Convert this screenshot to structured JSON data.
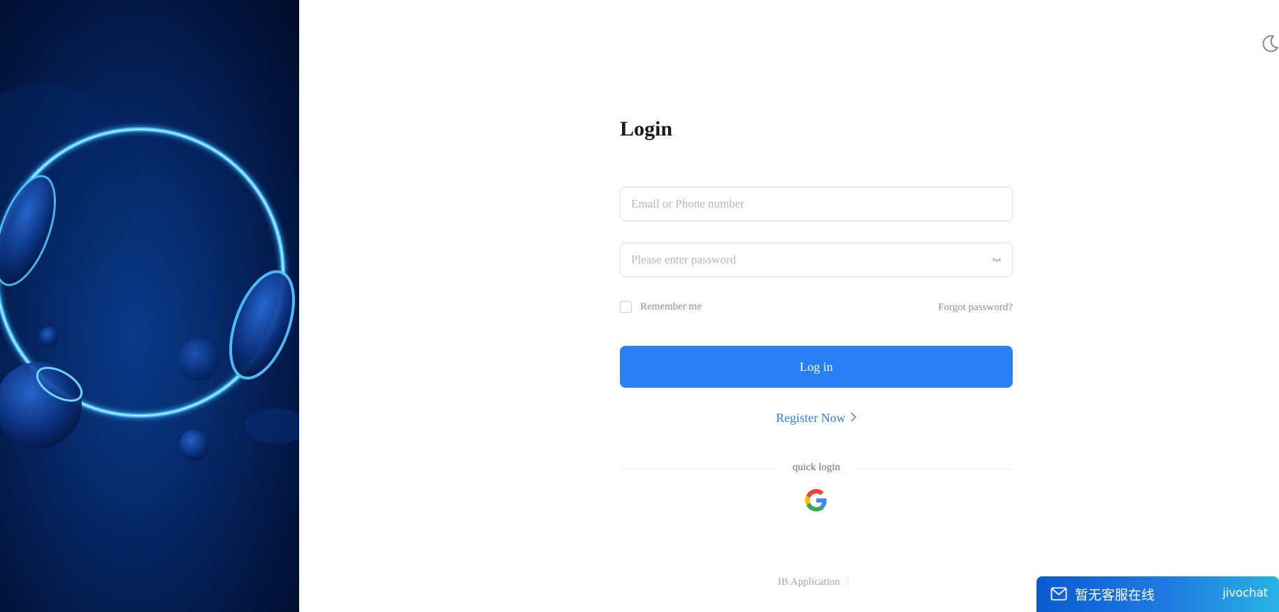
{
  "login": {
    "title": "Login",
    "email_placeholder": "Email or Phone number",
    "password_placeholder": "Please enter password",
    "remember_label": "Remember me",
    "forgot_label": "Forgot password?",
    "login_button_label": "Log in",
    "register_label": "Register Now",
    "quick_login_label": "quick login",
    "quick_login_providers": [
      "google"
    ]
  },
  "footer": {
    "ib_application_label": "IB Application"
  },
  "chat_widget": {
    "status_text": "暂无客服在线",
    "brand": "jivochat"
  },
  "icons": {
    "theme_toggle": "moon-icon",
    "password_toggle": "eye-closed-icon",
    "register_arrow": "chevron-right-icon",
    "chat": "mail-icon",
    "google": "google-icon"
  },
  "colors": {
    "accent": "#2a7ef6",
    "panel_dark": "#031a4a",
    "ring_glow": "#4fc3ff"
  }
}
